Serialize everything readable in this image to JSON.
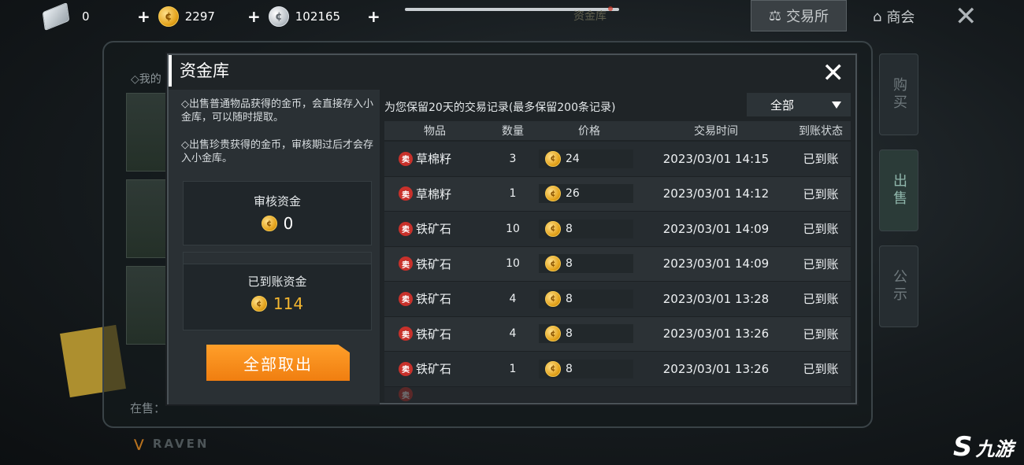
{
  "topbar": {
    "ticket_count": "0",
    "gold_count": "2297",
    "silver_count": "102165",
    "plus_symbol": "+",
    "ghost_tab": "资金库",
    "exchange_label": "交易所",
    "shop_label": "商会",
    "close_symbol": "✕"
  },
  "background": {
    "my_label": "◇我的",
    "on_sale_label": "在售：",
    "raven_label": "RAVEN",
    "side_tabs": [
      "购买",
      "出售",
      "公示"
    ]
  },
  "modal": {
    "title": "资金库",
    "close_symbol": "✕",
    "notes": [
      "◇出售普通物品获得的金币，会直接存入小金库，可以随时提取。",
      "◇出售珍贵获得的金币，审核期过后才会存入小金库。"
    ],
    "pending": {
      "label": "审核资金",
      "value": "0"
    },
    "arrived": {
      "label": "已到账资金",
      "value": "114"
    },
    "withdraw_button": "全部取出",
    "records_note": "为您保留20天的交易记录(最多保留200条记录)",
    "filter_selected": "全部",
    "columns": [
      "物品",
      "数量",
      "价格",
      "交易时间",
      "到账状态"
    ],
    "sell_badge": "卖",
    "rows": [
      {
        "item": "草棉籽",
        "qty": "3",
        "price": "24",
        "time": "2023/03/01  14:15",
        "status": "已到账"
      },
      {
        "item": "草棉籽",
        "qty": "1",
        "price": "26",
        "time": "2023/03/01  14:12",
        "status": "已到账"
      },
      {
        "item": "铁矿石",
        "qty": "10",
        "price": "8",
        "time": "2023/03/01  14:09",
        "status": "已到账"
      },
      {
        "item": "铁矿石",
        "qty": "10",
        "price": "8",
        "time": "2023/03/01  14:09",
        "status": "已到账"
      },
      {
        "item": "铁矿石",
        "qty": "4",
        "price": "8",
        "time": "2023/03/01  13:28",
        "status": "已到账"
      },
      {
        "item": "铁矿石",
        "qty": "4",
        "price": "8",
        "time": "2023/03/01  13:26",
        "status": "已到账"
      },
      {
        "item": "铁矿石",
        "qty": "1",
        "price": "8",
        "time": "2023/03/01  13:26",
        "status": "已到账"
      }
    ]
  },
  "watermark": {
    "symbol": "S",
    "text": "九游"
  },
  "colors": {
    "accent_orange": "#f08a1c",
    "gold_text": "#f3b62f",
    "sell_red": "#c8312b"
  },
  "icons": {
    "ticket": "ticket-icon",
    "gold_coin": "gold-coin-icon",
    "silver_coin": "silver-coin-icon",
    "filter_arrow": "triangle-down-icon"
  }
}
